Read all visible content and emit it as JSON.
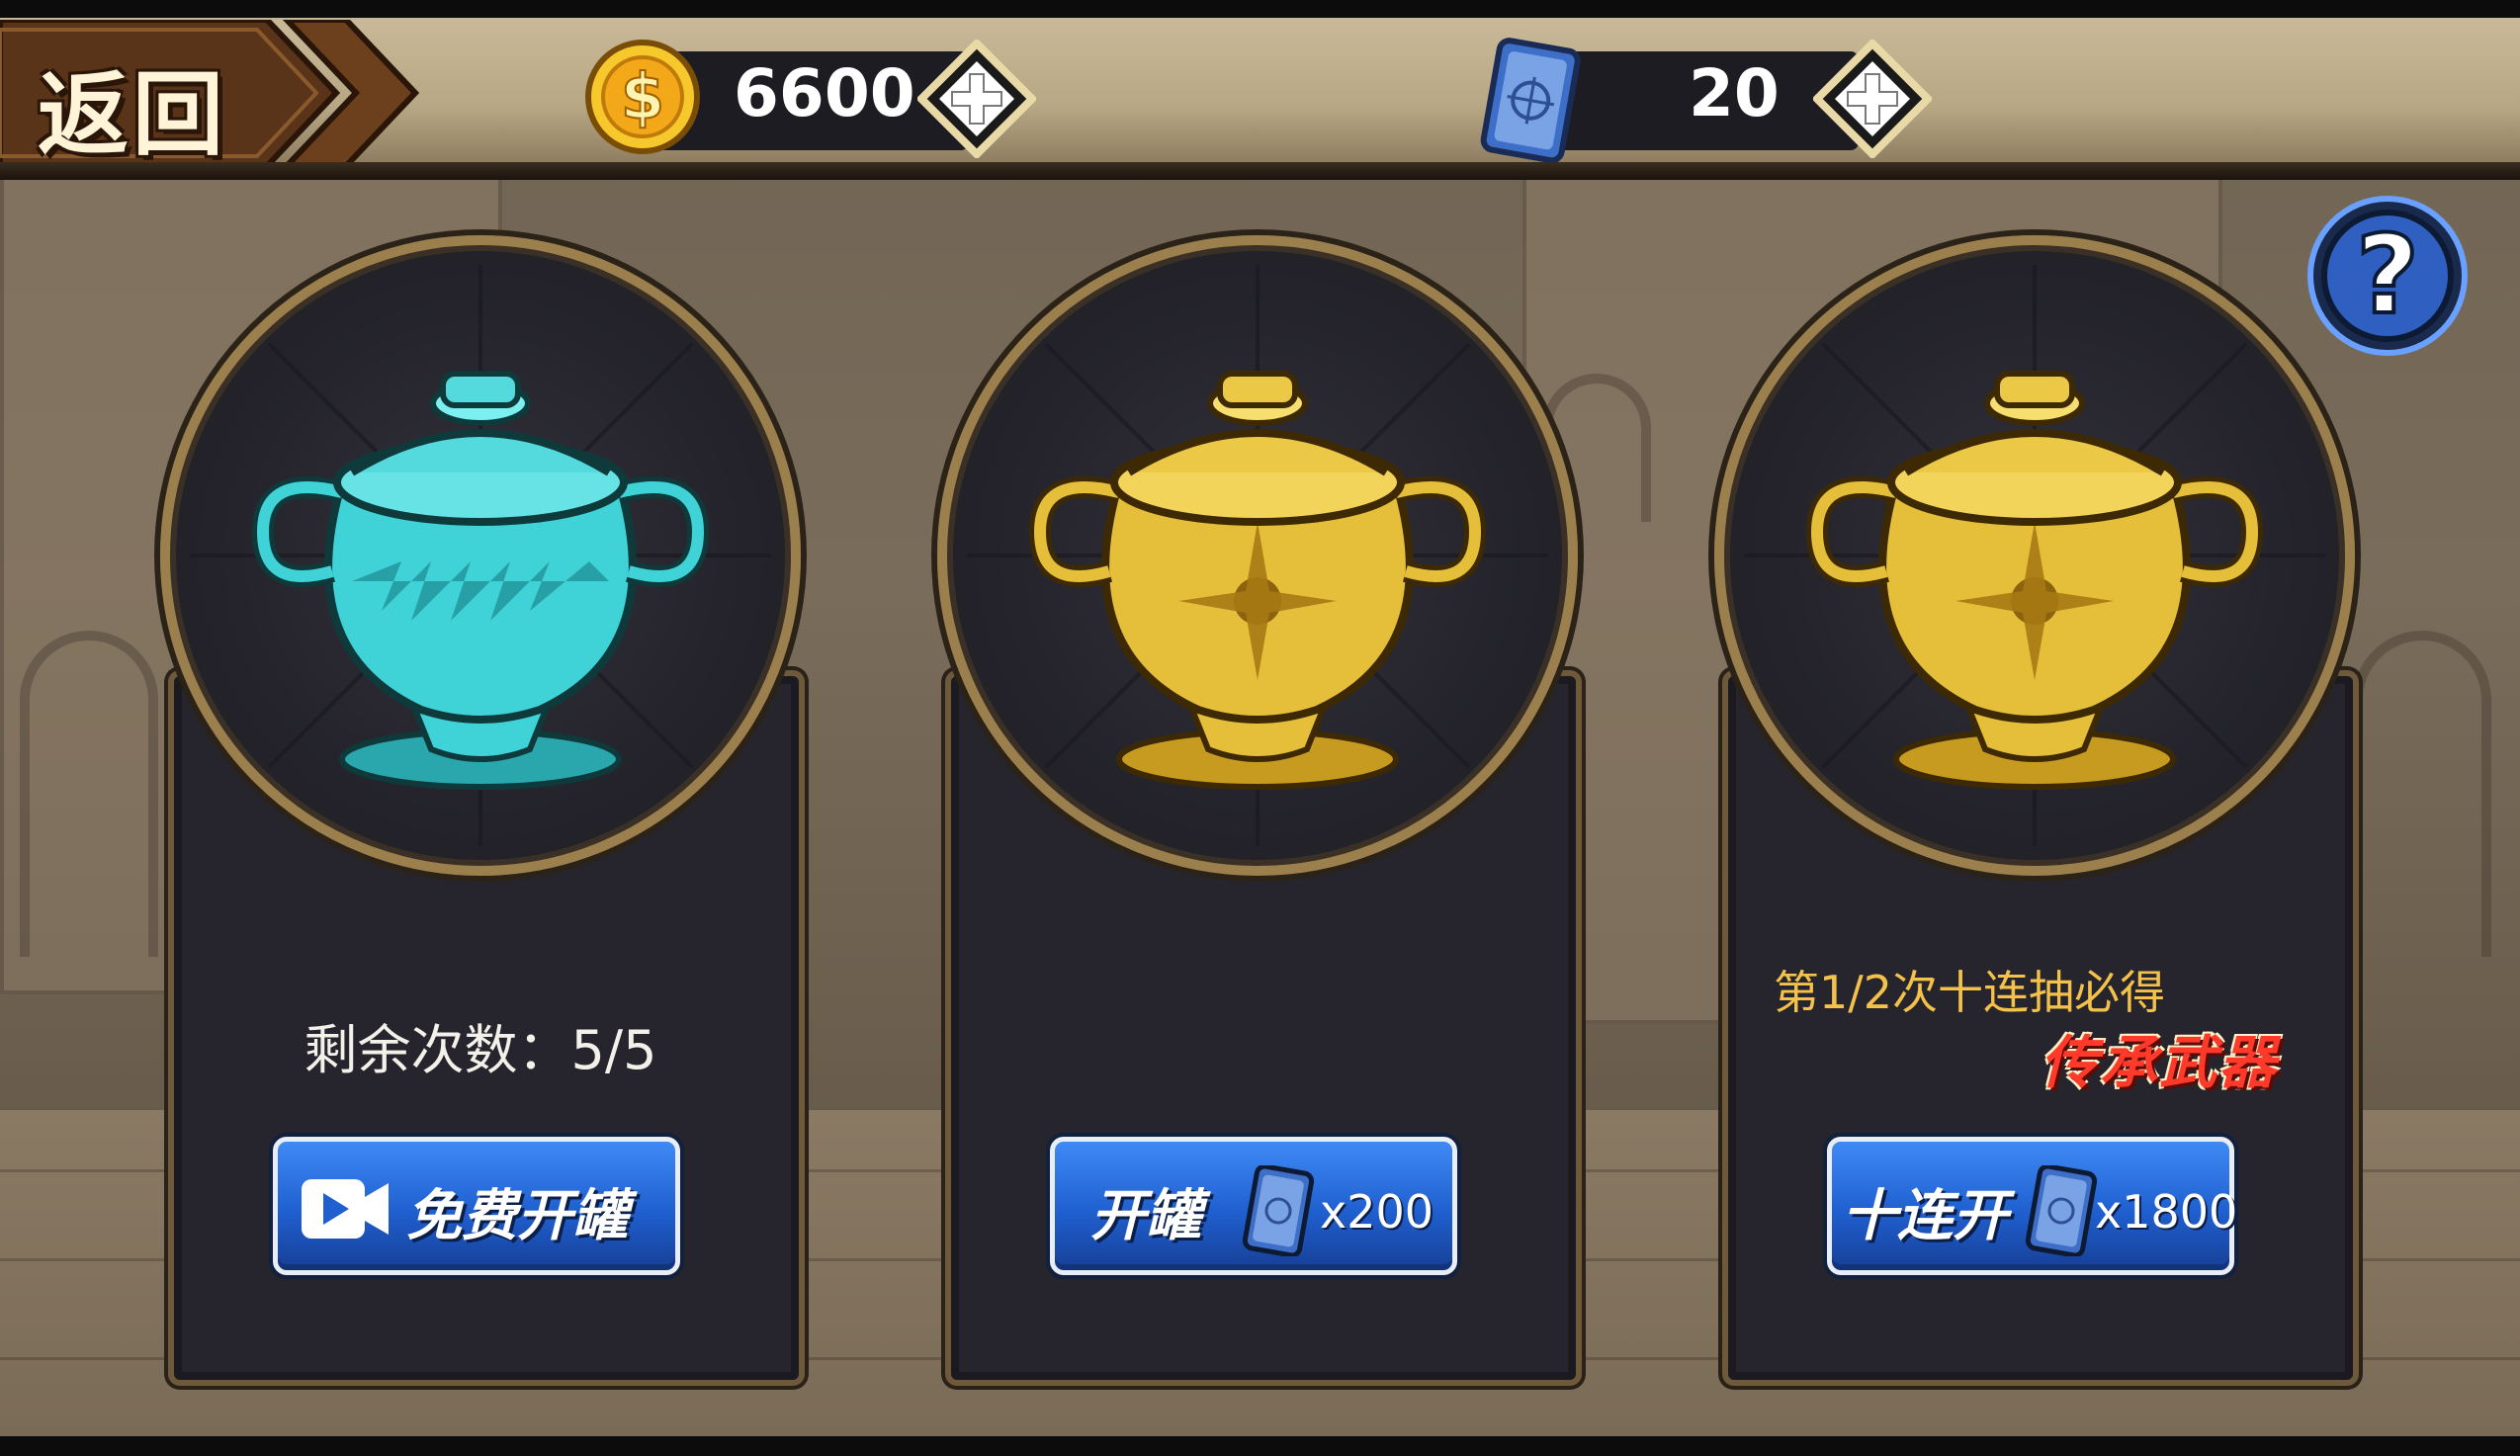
{
  "topbar": {
    "back_label": "返回",
    "gold": {
      "value": "6600",
      "icon": "gold-coin-icon",
      "add_icon": "plus-icon"
    },
    "cards": {
      "value": "20",
      "icon": "card-icon",
      "add_icon": "plus-icon"
    }
  },
  "help": {
    "icon": "question-mark-icon"
  },
  "pots": [
    {
      "pot_color": "#3fd3d8",
      "remaining_text": "剩余次数：5/5",
      "button": {
        "label": "免费开罐",
        "icon": "video-icon"
      }
    },
    {
      "pot_color": "#e5bf3a",
      "button": {
        "label": "开罐",
        "icon": "card-icon",
        "cost": "x200"
      }
    },
    {
      "pot_color": "#e5bf3a",
      "promo_line1": "第1/2次十连抽必得",
      "promo_line2": "传承武器",
      "button": {
        "label": "十连开",
        "icon": "card-icon",
        "cost": "x1800"
      }
    }
  ],
  "colors": {
    "button_blue": "#1f5fcf",
    "promo_gold": "#f4c24a",
    "promo_red": "#ff3a2a",
    "frame_gold": "#9b7f4c"
  }
}
